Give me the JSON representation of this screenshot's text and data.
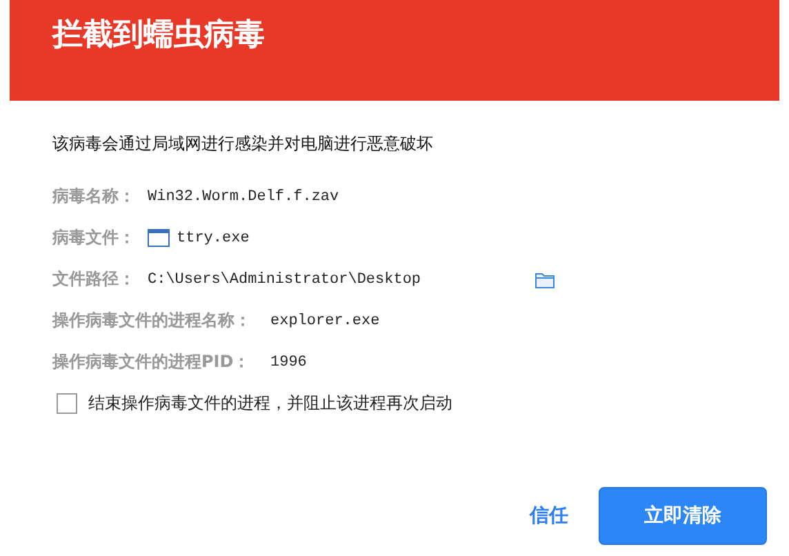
{
  "header": {
    "title": "拦截到蠕虫病毒"
  },
  "description": "该病毒会通过局域网进行感染并对电脑进行恶意破坏",
  "details": [
    {
      "kind": "plain",
      "label": "病毒名称：",
      "value": "Win32.Worm.Delf.f.zav"
    },
    {
      "kind": "file",
      "label": "病毒文件：",
      "value": "ttry.exe"
    },
    {
      "kind": "path",
      "label": "文件路径：",
      "value": "C:\\Users\\Administrator\\Desktop"
    }
  ],
  "process_details": [
    {
      "label": "操作病毒文件的进程名称：",
      "value": "explorer.exe"
    },
    {
      "label": "操作病毒文件的进程PID：",
      "value": "1996"
    }
  ],
  "option": {
    "label": "结束操作病毒文件的进程，并阻止该进程再次启动",
    "checked": false
  },
  "buttons": {
    "secondary": "信任",
    "primary": "立即清除"
  }
}
